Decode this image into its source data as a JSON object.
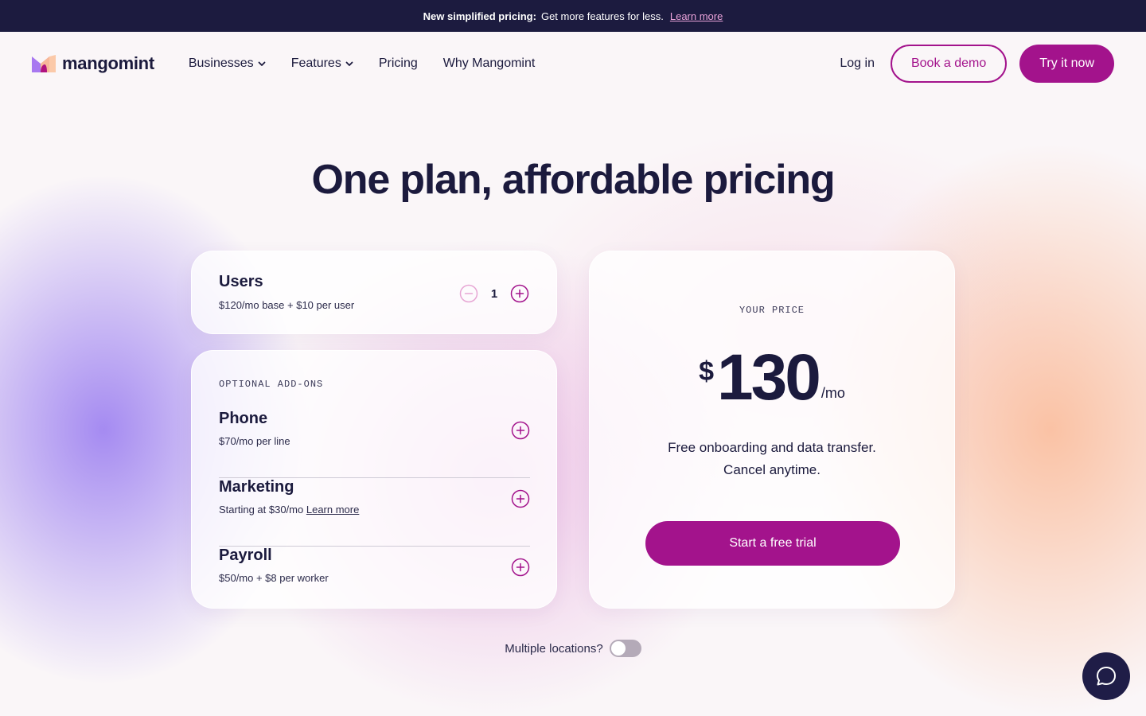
{
  "announcement": {
    "bold_text": "New simplified pricing:",
    "text": "Get more features for less.",
    "link": "Learn more"
  },
  "header": {
    "logo_text": "mangomint",
    "nav": [
      {
        "label": "Businesses",
        "has_dropdown": true
      },
      {
        "label": "Features",
        "has_dropdown": true
      },
      {
        "label": "Pricing",
        "has_dropdown": false
      },
      {
        "label": "Why Mangomint",
        "has_dropdown": false
      }
    ],
    "login": "Log in",
    "demo_button": "Book a demo",
    "try_button": "Try it now"
  },
  "page_title": "One plan, affordable pricing",
  "users_card": {
    "title": "Users",
    "subtitle": "$120/mo base + $10 per user",
    "quantity": "1"
  },
  "addons": {
    "label": "OPTIONAL ADD-ONS",
    "items": [
      {
        "name": "Phone",
        "subtitle": "$70/mo per line",
        "link": ""
      },
      {
        "name": "Marketing",
        "subtitle": "Starting at $30/mo",
        "link": "Learn more"
      },
      {
        "name": "Payroll",
        "subtitle": "$50/mo + $8 per worker",
        "link": ""
      }
    ]
  },
  "price_card": {
    "label": "YOUR PRICE",
    "currency": "$",
    "amount": "130",
    "period": "/mo",
    "note_line1": "Free onboarding and data transfer.",
    "note_line2": "Cancel anytime.",
    "cta": "Start a free trial"
  },
  "multiple_locations": {
    "label": "Multiple locations?",
    "enabled": false
  },
  "colors": {
    "brand": "#a3138c",
    "navy": "#1c1b3f",
    "text": "#1b1a3d"
  },
  "icons": [
    "chevron-down-icon",
    "minus-circle-icon",
    "plus-circle-icon",
    "chat-icon",
    "mangomint-logo"
  ]
}
